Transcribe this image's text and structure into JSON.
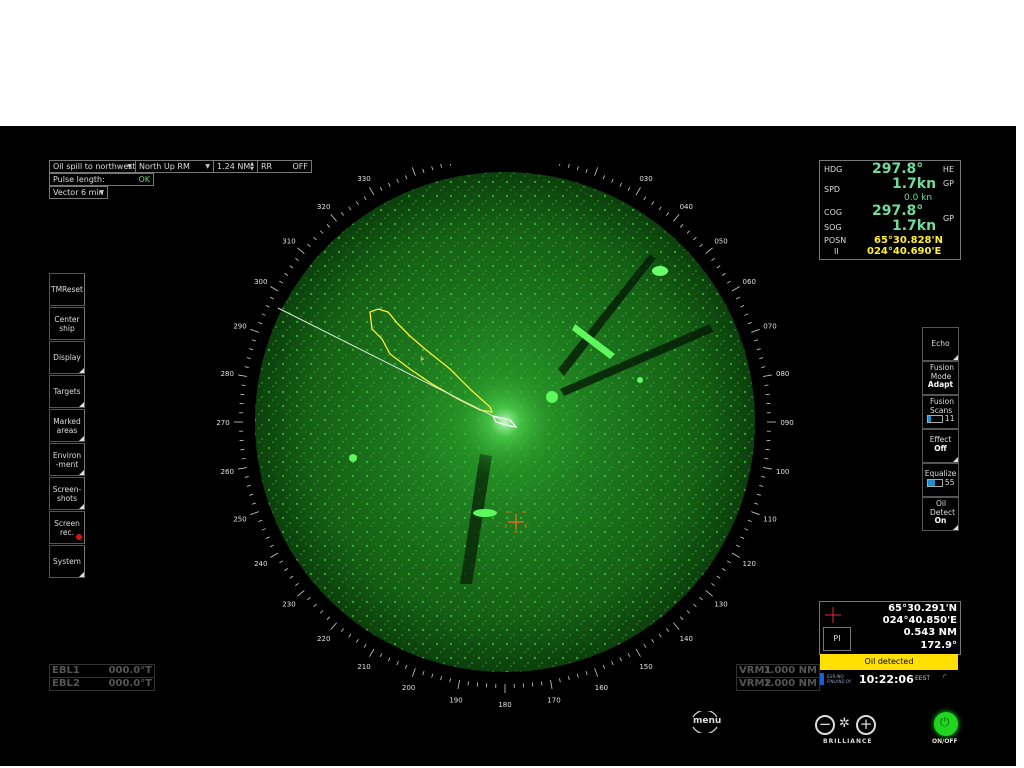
{
  "top_controls": {
    "scenario": "Oil spill to northwest",
    "orientation": "North Up RM",
    "range": "1.24 NM",
    "rr_label": "RR",
    "rr_value": "OFF",
    "pulse_label": "Pulse length:",
    "pulse_value": "OK",
    "vector": "Vector 6 min"
  },
  "left_menu": [
    {
      "label": "TMReset"
    },
    {
      "label": "Center ship"
    },
    {
      "label": "Display"
    },
    {
      "label": "Targets"
    },
    {
      "label": "Marked areas"
    },
    {
      "label": "Environ-ment"
    },
    {
      "label": "Screen-shots"
    },
    {
      "label": "Screen rec."
    },
    {
      "label": "System"
    }
  ],
  "nav_panel": {
    "hdg_label": "HDG",
    "hdg_value": "297.8°",
    "hdg_src": "HE",
    "spd_label": "SPD",
    "spd_value": "1.7kn",
    "spd_sub": "0.0 kn",
    "spd_src": "GP",
    "cog_label": "COG",
    "cog_value": "297.8°",
    "sog_label": "SOG",
    "sog_value": "1.7kn",
    "cog_src": "GP",
    "posn_label": "POSN",
    "posn_sub": "II",
    "lat": "65°30.828'N",
    "lon": "024°40.690'E"
  },
  "right_menu": {
    "echo": "Echo",
    "fusion_mode_label": "Fusion Mode",
    "fusion_mode_value": "Adapt",
    "fusion_scans_label": "Fusion Scans",
    "fusion_scans_value": "11",
    "fusion_scans_fraction": 0.25,
    "effect_label": "Effect",
    "effect_value": "Off",
    "equalize_label": "Equalize",
    "equalize_value": "55",
    "equalize_fraction": 0.55,
    "oil_detect_label": "Oil Detect",
    "oil_detect_value": "On"
  },
  "cursor_panel": {
    "lat": "65°30.291'N",
    "lon": "024°40.850'E",
    "range": "0.543 NM",
    "bearing": "172.9°",
    "pi_label": "PI"
  },
  "alert": "Oil detected",
  "clock": {
    "time": "10:22:06",
    "zone": "EEST",
    "brand": "EUR.INO FINLAND OY"
  },
  "ebl": [
    {
      "label": "EBL1",
      "value": "000.0°T"
    },
    {
      "label": "EBL2",
      "value": "000.0°T"
    }
  ],
  "vrm": [
    {
      "label": "VRM1",
      "value": "1.000 NM"
    },
    {
      "label": "VRM2",
      "value": "1.000 NM"
    }
  ],
  "bottom_controls": {
    "menu_label": "menu",
    "brilliance_label": "BRILLIANCE",
    "onoff_label": "ON/OFF"
  },
  "bearing_ring_labels": [
    "000",
    "010",
    "020",
    "030",
    "040",
    "050",
    "060",
    "070",
    "080",
    "090",
    "100",
    "110",
    "120",
    "130",
    "140",
    "150",
    "160",
    "170",
    "180",
    "190",
    "200",
    "210",
    "220",
    "230",
    "240",
    "250",
    "260",
    "270",
    "280",
    "290",
    "300",
    "310",
    "320",
    "330",
    "340",
    "350"
  ],
  "colors": {
    "echo": "#19d019",
    "oil_outline": "#ffee33",
    "nav_value": "#6fdc9a",
    "alert": "#ffe000",
    "power": "#1fd51f"
  }
}
